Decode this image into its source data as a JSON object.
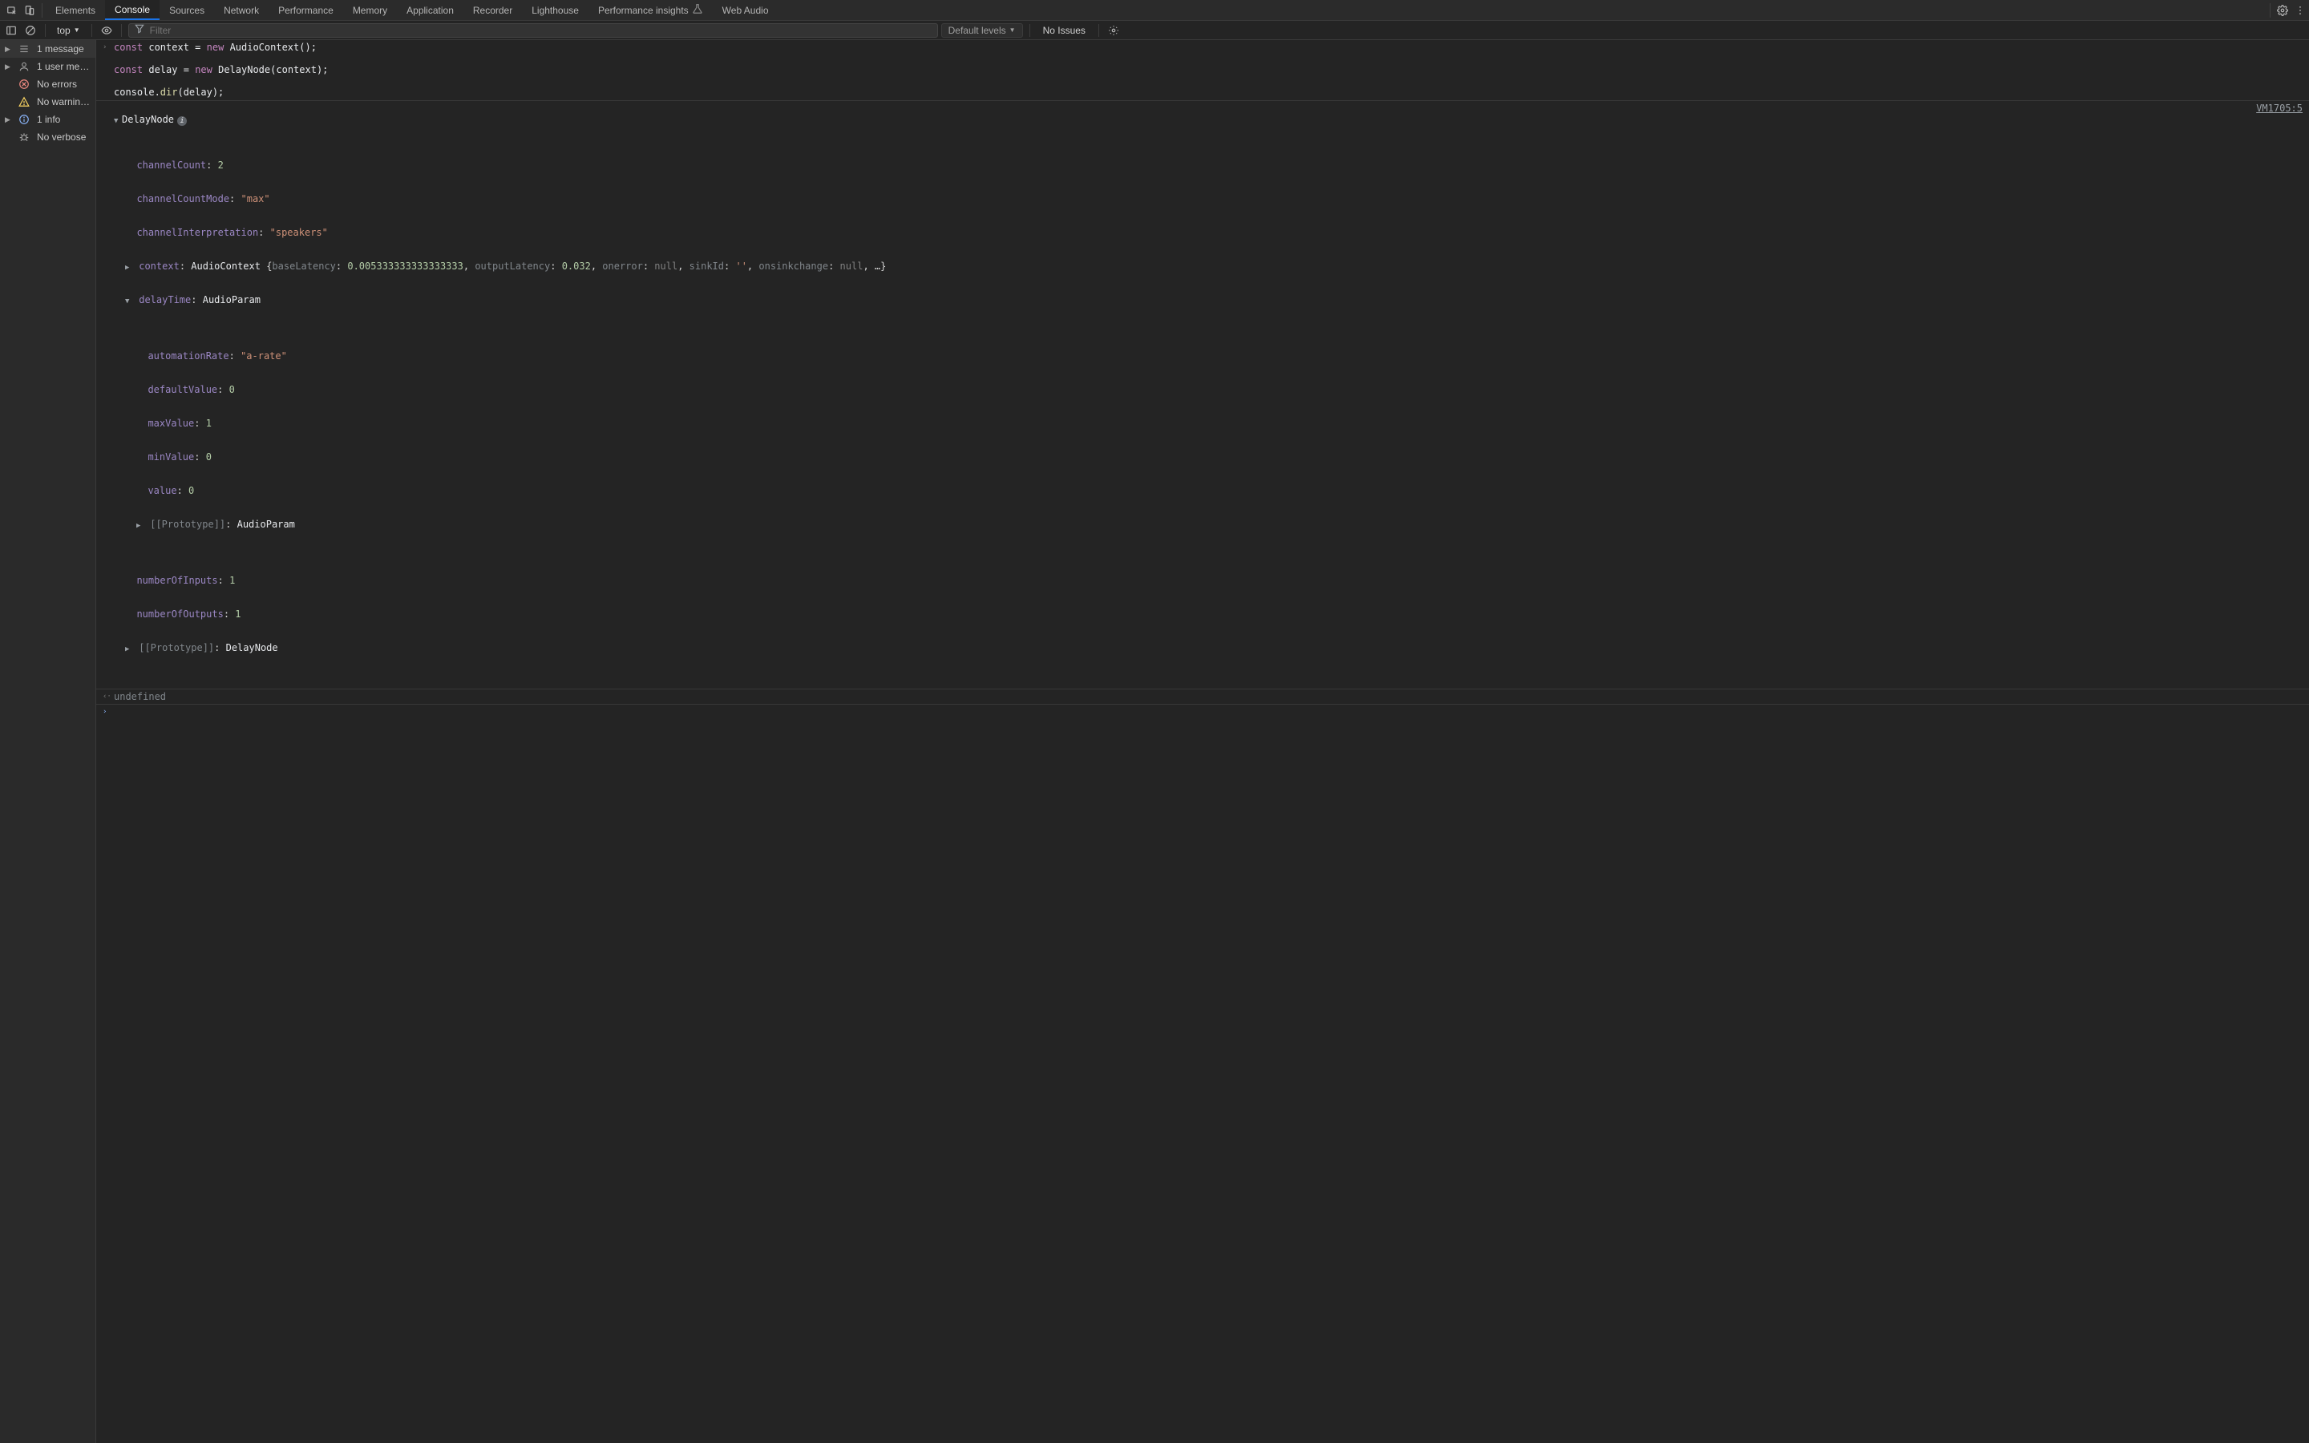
{
  "tabs": {
    "items": [
      "Elements",
      "Console",
      "Sources",
      "Network",
      "Performance",
      "Memory",
      "Application",
      "Recorder",
      "Lighthouse",
      "Performance insights",
      "Web Audio"
    ],
    "active": "Console"
  },
  "toolbar": {
    "context": "top",
    "filter_placeholder": "Filter",
    "levels_label": "Default levels",
    "issues_label": "No Issues"
  },
  "sidebar": {
    "items": [
      {
        "icon": "messages",
        "label": "1 message",
        "expandable": true
      },
      {
        "icon": "user",
        "label": "1 user me…",
        "expandable": true
      },
      {
        "icon": "error",
        "label": "No errors"
      },
      {
        "icon": "warn",
        "label": "No warnin…"
      },
      {
        "icon": "info",
        "label": "1 info",
        "expandable": true
      },
      {
        "icon": "verbose",
        "label": "No verbose"
      }
    ]
  },
  "code": {
    "l1": {
      "const": "const",
      "ctx": "context",
      "eq": "=",
      "new": "new",
      "call": "AudioContext",
      "tail": "();"
    },
    "l2": {
      "const": "const",
      "dly": "delay",
      "eq": "=",
      "new": "new",
      "call": "DelayNode",
      "tail": "(context);"
    },
    "l3": {
      "pre": "console.",
      "fn": "dir",
      "tail": "(delay);"
    }
  },
  "dir": {
    "source_link": "VM1705:5",
    "root": "DelayNode",
    "props": {
      "channelCount": {
        "k": "channelCount",
        "v": "2"
      },
      "channelCountMode": {
        "k": "channelCountMode",
        "v": "\"max\""
      },
      "channelInterpretation": {
        "k": "channelInterpretation",
        "v": "\"speakers\""
      },
      "context_line": "context: AudioContext {baseLatency: 0.005333333333333333, outputLatency: 0.032, onerror: null, sinkId: '', onsinkchange: null, …}",
      "context": {
        "k": "context",
        "cls": "AudioContext",
        "baseLatency_k": "baseLatency",
        "baseLatency_v": "0.005333333333333333",
        "outputLatency_k": "outputLatency",
        "outputLatency_v": "0.032",
        "onerror_k": "onerror",
        "onerror_v": "null",
        "sinkId_k": "sinkId",
        "sinkId_v": "''",
        "onsinkchange_k": "onsinkchange",
        "onsinkchange_v": "null"
      },
      "delayTime": {
        "k": "delayTime",
        "cls": "AudioParam",
        "automationRate": {
          "k": "automationRate",
          "v": "\"a-rate\""
        },
        "defaultValue": {
          "k": "defaultValue",
          "v": "0"
        },
        "maxValue": {
          "k": "maxValue",
          "v": "1"
        },
        "minValue": {
          "k": "minValue",
          "v": "0"
        },
        "value": {
          "k": "value",
          "v": "0"
        },
        "proto": {
          "k": "[[Prototype]]",
          "v": "AudioParam"
        }
      },
      "numberOfInputs": {
        "k": "numberOfInputs",
        "v": "1"
      },
      "numberOfOutputs": {
        "k": "numberOfOutputs",
        "v": "1"
      },
      "proto": {
        "k": "[[Prototype]]",
        "v": "DelayNode"
      }
    }
  },
  "result": "undefined",
  "prompt": ""
}
